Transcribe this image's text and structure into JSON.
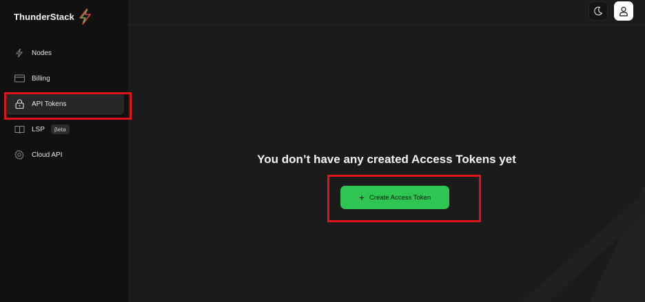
{
  "brand": {
    "name": "ThunderStack",
    "logo_icon": "lightning-bolt-icon"
  },
  "sidebar": {
    "items": [
      {
        "label": "Nodes",
        "icon": "lightning-outline-icon"
      },
      {
        "label": "Billing",
        "icon": "credit-card-icon"
      },
      {
        "label": "API Tokens",
        "icon": "lock-icon",
        "active": true
      },
      {
        "label": "LSP",
        "icon": "book-icon",
        "badge": "βeta"
      },
      {
        "label": "Cloud API",
        "icon": "gear-icon"
      }
    ]
  },
  "topbar": {
    "theme_toggle_icon": "moon-icon",
    "user_icon": "user-icon"
  },
  "main": {
    "empty_title": "You don’t have any created Access Tokens yet",
    "create_button": {
      "label": "Create Access Token",
      "icon": "plus-icon"
    }
  },
  "colors": {
    "accent_green": "#2fc553",
    "highlight_red": "#e0141b",
    "sidebar_bg": "#111111",
    "main_bg": "#1b1b1b"
  }
}
